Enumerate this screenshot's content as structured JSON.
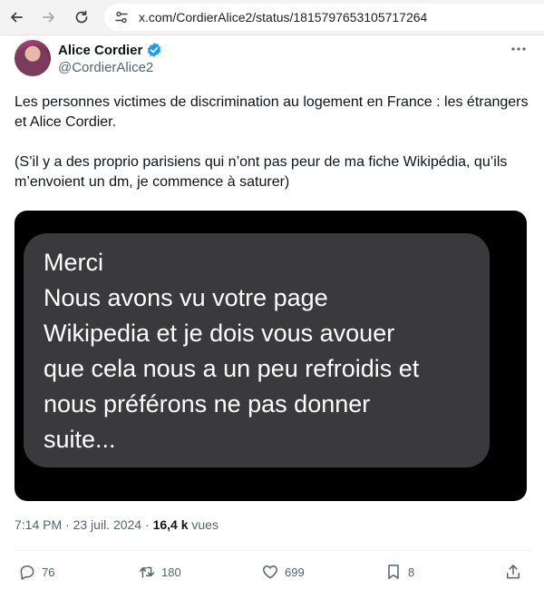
{
  "browser": {
    "url": "x.com/CordierAlice2/status/1815797653105717264",
    "icons": {
      "back": "arrow-left-icon",
      "forward": "arrow-right-icon",
      "reload": "reload-icon",
      "site_info": "tune-icon"
    }
  },
  "tweet": {
    "author": {
      "name": "Alice Cordier",
      "handle": "@CordierAlice2",
      "verified": true
    },
    "text": [
      "Les personnes victimes de discrimination au logement en France : les étrangers et Alice Cordier.",
      "(S’il y a des proprio parisiens qui n’ont pas peur de ma fiche Wikipédia, qu’ils m’envoient un dm, je commence à saturer)"
    ],
    "image_message_lines": [
      "Merci",
      "Nous avons vu votre page",
      "Wikipedia et je dois vous avouer",
      "que cela nous a un peu refroidis et",
      "nous préférons ne pas donner",
      "suite..."
    ],
    "meta": {
      "time": "7:14 PM",
      "date": "23 juil. 2024",
      "separator": "·",
      "views_count": "16,4 k",
      "views_label": "vues"
    },
    "actions": {
      "replies": "76",
      "retweets": "180",
      "likes": "699",
      "bookmarks": "8"
    }
  },
  "colors": {
    "accent_verified": "#1d9bf0",
    "muted_text": "#536471",
    "bubble_bg": "#3a3a3c"
  }
}
